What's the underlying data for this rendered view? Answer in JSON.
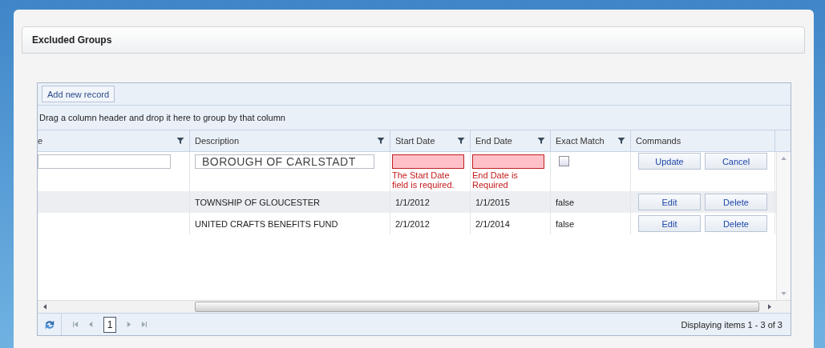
{
  "panel": {
    "title": "Excluded Groups"
  },
  "toolbar": {
    "add_button": "Add new record"
  },
  "group_panel": {
    "hint": "Drag a column header and drop it here to group by that column"
  },
  "columns": [
    {
      "label": "e",
      "filter": true
    },
    {
      "label": "Description",
      "filter": true
    },
    {
      "label": "Start Date",
      "filter": true
    },
    {
      "label": "End Date",
      "filter": true
    },
    {
      "label": "Exact Match",
      "filter": true
    },
    {
      "label": "Commands",
      "filter": false
    }
  ],
  "edit_row": {
    "description": "BOROUGH OF CARLSTADT",
    "start_date": {
      "invalid": true,
      "error": "The Start Date field is required."
    },
    "end_date": {
      "invalid": true,
      "error": "End Date is Required"
    },
    "exact_match_checked": false,
    "buttons": [
      "Update",
      "Cancel"
    ]
  },
  "rows": [
    {
      "description": "TOWNSHIP OF GLOUCESTER",
      "start_date": "1/1/2012",
      "end_date": "1/1/2015",
      "exact_match": "false",
      "buttons": [
        "Edit",
        "Delete"
      ]
    },
    {
      "description": "UNITED CRAFTS BENEFITS FUND",
      "start_date": "2/1/2012",
      "end_date": "2/1/2014",
      "exact_match": "false",
      "buttons": [
        "Edit",
        "Delete"
      ]
    }
  ],
  "pager": {
    "page": "1",
    "info": "Displaying items 1 - 3 of 3"
  }
}
